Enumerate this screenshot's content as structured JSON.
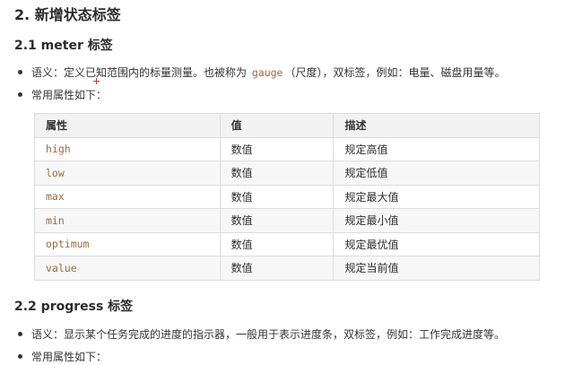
{
  "section_title": "2. 新增状态标签",
  "meter": {
    "heading": "2.1 meter 标签",
    "desc_prefix": "语义：定义已知范围内的标量测量。也被称为",
    "desc_code": "gauge",
    "desc_suffix": "（尺度），双标签，例如：电量、磁盘用量等。",
    "attrs_intro": "常用属性如下：",
    "table": {
      "headers": [
        "属性",
        "值",
        "描述"
      ],
      "rows": [
        {
          "attr": "high",
          "value": "数值",
          "desc": "规定高值"
        },
        {
          "attr": "low",
          "value": "数值",
          "desc": "规定低值"
        },
        {
          "attr": "max",
          "value": "数值",
          "desc": "规定最大值"
        },
        {
          "attr": "min",
          "value": "数值",
          "desc": "规定最小值"
        },
        {
          "attr": "optimum",
          "value": "数值",
          "desc": "规定最优值"
        },
        {
          "attr": "value",
          "value": "数值",
          "desc": "规定当前值"
        }
      ]
    }
  },
  "progress": {
    "heading": "2.2 progress 标签",
    "desc": "语义：显示某个任务完成的进度的指示器，一般用于表示进度条，双标签，例如：工作完成进度等。",
    "attrs_intro": "常用属性如下："
  }
}
